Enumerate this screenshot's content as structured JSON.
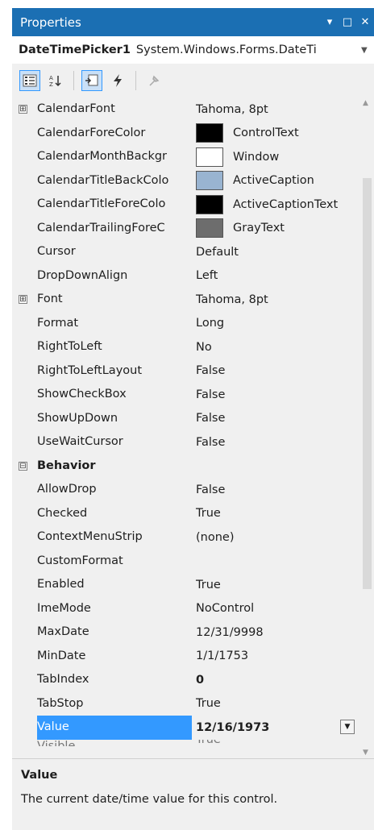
{
  "title_bar": {
    "title": "Properties",
    "pin_glyph": "▾",
    "maximize_glyph": "□",
    "close_glyph": "✕"
  },
  "object_selector": {
    "name": "DateTimePicker1",
    "type": "System.Windows.Forms.DateTi",
    "dropdown_icon": "chevron-down-icon"
  },
  "toolbar": {
    "buttons": [
      {
        "icon": "categorized-icon",
        "active": true
      },
      {
        "icon": "alphabetical-icon",
        "active": false
      },
      {
        "icon": "properties-icon",
        "active": true
      },
      {
        "icon": "events-icon",
        "active": false
      },
      {
        "icon": "property-pages-icon",
        "active": false
      }
    ]
  },
  "colors": {
    "title_bar": "#1b6fb3",
    "selection": "#3399ff",
    "control_text": "#000000",
    "window": "#ffffff",
    "active_caption": "#99b4d1",
    "active_caption_text": "#000000",
    "gray_text": "#6d6d6d"
  },
  "rows": [
    {
      "name": "CalendarFont",
      "value": "Tahoma, 8pt",
      "expand": "⊞"
    },
    {
      "name": "CalendarForeColor",
      "value": "ControlText",
      "swatch": "#000000"
    },
    {
      "name": "CalendarMonthBackgr",
      "value": "Window",
      "swatch": "#ffffff"
    },
    {
      "name": "CalendarTitleBackColo",
      "value": "ActiveCaption",
      "swatch": "#99b4d1"
    },
    {
      "name": "CalendarTitleForeColo",
      "value": "ActiveCaptionText",
      "swatch": "#000000"
    },
    {
      "name": "CalendarTrailingForeC",
      "value": "GrayText",
      "swatch": "#6d6d6d"
    },
    {
      "name": "Cursor",
      "value": "Default"
    },
    {
      "name": "DropDownAlign",
      "value": "Left"
    },
    {
      "name": "Font",
      "value": "Tahoma, 8pt",
      "expand": "⊞"
    },
    {
      "name": "Format",
      "value": "Long"
    },
    {
      "name": "RightToLeft",
      "value": "No"
    },
    {
      "name": "RightToLeftLayout",
      "value": "False"
    },
    {
      "name": "ShowCheckBox",
      "value": "False"
    },
    {
      "name": "ShowUpDown",
      "value": "False"
    },
    {
      "name": "UseWaitCursor",
      "value": "False"
    },
    {
      "name": "Behavior",
      "value": "",
      "expand": "⊟",
      "category": true
    },
    {
      "name": "AllowDrop",
      "value": "False"
    },
    {
      "name": "Checked",
      "value": "True"
    },
    {
      "name": "ContextMenuStrip",
      "value": "(none)"
    },
    {
      "name": "CustomFormat",
      "value": ""
    },
    {
      "name": "Enabled",
      "value": "True"
    },
    {
      "name": "ImeMode",
      "value": "NoControl"
    },
    {
      "name": "MaxDate",
      "value": "12/31/9998"
    },
    {
      "name": "MinDate",
      "value": "1/1/1753"
    },
    {
      "name": "TabIndex",
      "value": "0",
      "bold": true
    },
    {
      "name": "TabStop",
      "value": "True"
    },
    {
      "name": "Value",
      "value": "12/16/1973",
      "bold": true,
      "selected": true,
      "dropdown": true
    },
    {
      "name": "Visible",
      "value": "True",
      "cut": true
    }
  ],
  "description": {
    "title": "Value",
    "text": "The current date/time value for this control."
  }
}
